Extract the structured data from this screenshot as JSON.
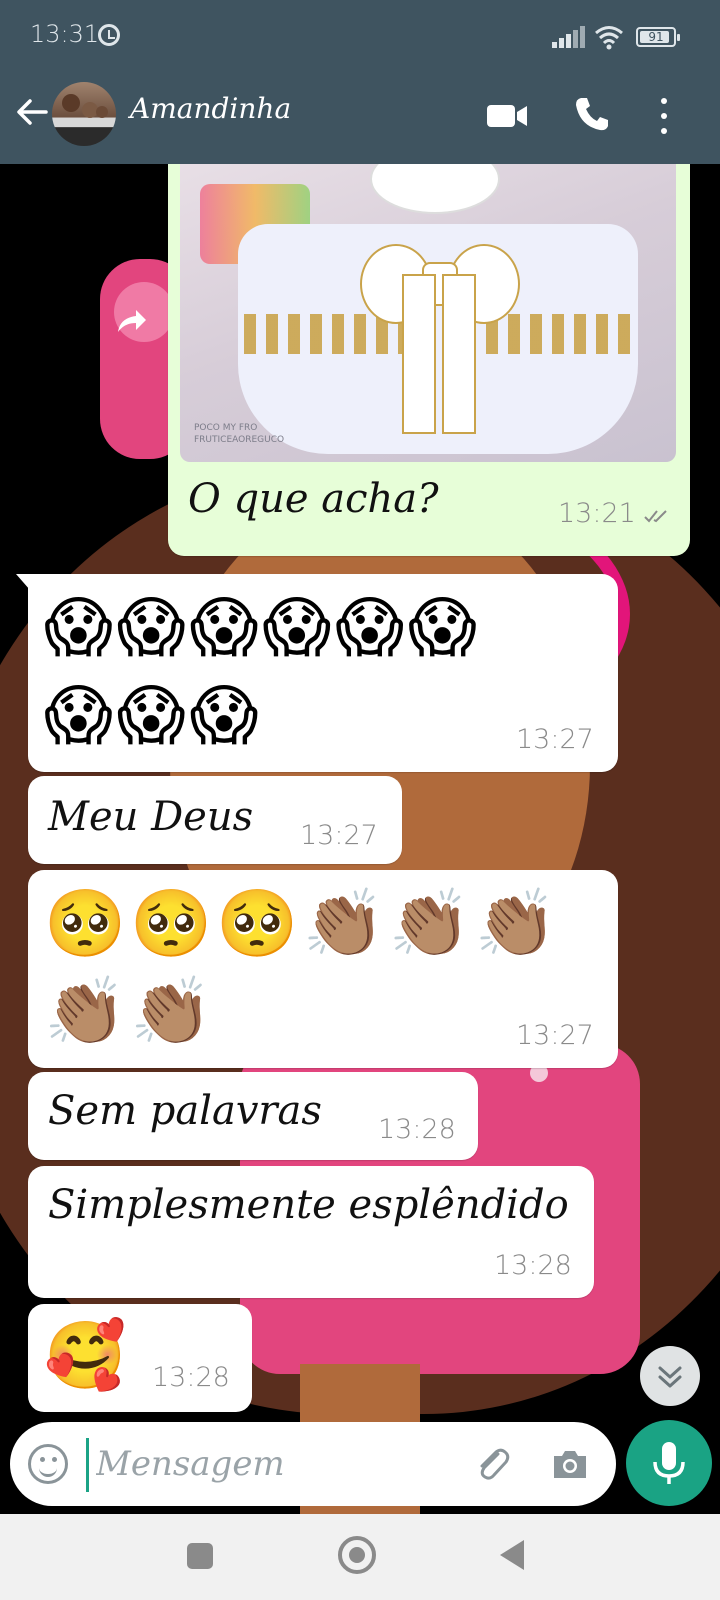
{
  "status_bar": {
    "time": "13:31",
    "battery_level": "91",
    "battery_fraction": 0.91,
    "icons": [
      "alarm-icon",
      "signal-icon",
      "wifi-icon",
      "battery-icon"
    ]
  },
  "header": {
    "contact_name": "Amandinha",
    "icons": [
      "back-arrow-icon",
      "video-call-icon",
      "phone-icon",
      "more-vert-icon"
    ],
    "color": "#3f5460"
  },
  "messages": [
    {
      "id": "m1",
      "direction": "outgoing",
      "type": "image",
      "caption": "O que acha?",
      "time": "13:21",
      "status": "delivered",
      "watermark": "POCO MY FRO\nFRUTICEAOREGUCO"
    },
    {
      "id": "m2",
      "direction": "incoming",
      "type": "emoji",
      "emoji_lines": [
        "😱😱😱😱😱😱",
        "😱😱😱"
      ],
      "time": "13:27"
    },
    {
      "id": "m3",
      "direction": "incoming",
      "type": "text",
      "text": "Meu Deus",
      "time": "13:27"
    },
    {
      "id": "m4",
      "direction": "incoming",
      "type": "emoji",
      "emoji_lines": [
        "🥺🥺🥺👏🏽👏🏽👏🏽",
        "👏🏽👏🏽"
      ],
      "time": "13:27"
    },
    {
      "id": "m5",
      "direction": "incoming",
      "type": "text",
      "text": "Sem palavras",
      "time": "13:28"
    },
    {
      "id": "m6",
      "direction": "incoming",
      "type": "text",
      "text": "Simplesmente esplêndido",
      "time": "13:28"
    },
    {
      "id": "m7",
      "direction": "incoming",
      "type": "emoji",
      "emoji_lines": [
        "🥰"
      ],
      "time": "13:28"
    }
  ],
  "composer": {
    "placeholder": "Mensagem",
    "icons": [
      "emoji-icon",
      "paperclip-icon",
      "camera-icon",
      "microphone-icon"
    ],
    "accent": "#1aa384"
  },
  "scroll_button": {
    "icon": "double-chevron-down-icon"
  },
  "nav_bar": {
    "icons": [
      "recents-icon",
      "home-icon",
      "back-icon"
    ]
  },
  "colors": {
    "outgoing_bubble": "#e7fed8",
    "incoming_bubble": "#ffffff",
    "time_text": "#8a8a8a"
  }
}
